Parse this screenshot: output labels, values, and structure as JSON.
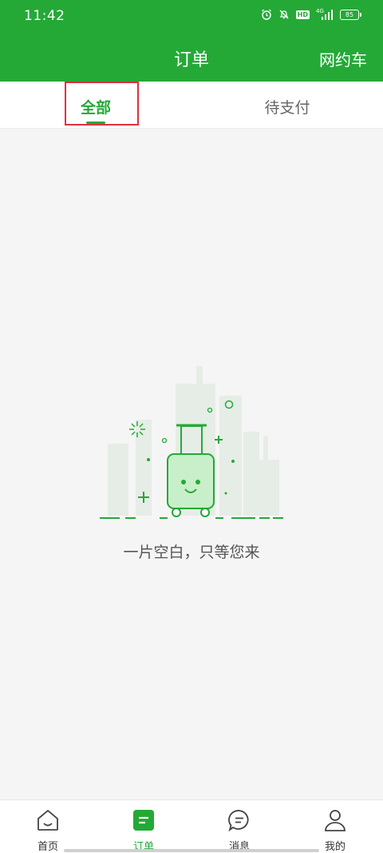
{
  "status_bar": {
    "time": "11:42",
    "icons": [
      "alarm-icon",
      "mute-bell-icon",
      "hd-icon",
      "signal-4g-icon",
      "battery-icon"
    ],
    "hd_label": "HD",
    "network_label": "4G",
    "battery": "85"
  },
  "header": {
    "title": "订单",
    "right_action": "网约车"
  },
  "tabs": [
    {
      "label": "全部",
      "selected": true
    },
    {
      "label": "待支付",
      "selected": false
    }
  ],
  "empty_state": {
    "icon": "empty-luggage-illustration",
    "message": "一片空白，只等您来"
  },
  "bottom_nav": [
    {
      "label": "首页",
      "icon": "home-icon",
      "active": false
    },
    {
      "label": "订单",
      "icon": "order-icon",
      "active": true
    },
    {
      "label": "消息",
      "icon": "message-icon",
      "active": false
    },
    {
      "label": "我的",
      "icon": "profile-icon",
      "active": false
    }
  ],
  "colors": {
    "brand_green": "#24a937",
    "highlight_red": "#e0303e",
    "background": "#f5f5f5"
  }
}
